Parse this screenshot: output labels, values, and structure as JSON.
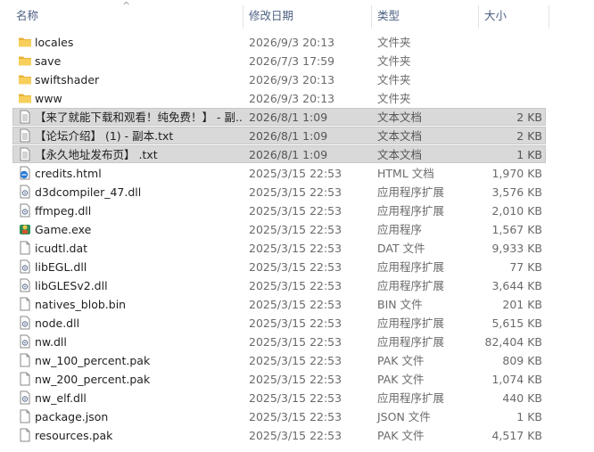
{
  "header": {
    "name": "名称",
    "date": "修改日期",
    "type": "类型",
    "size": "大小"
  },
  "rows": [
    {
      "name": "locales",
      "date": "2026/9/3 20:13",
      "type": "文件夹",
      "size": "",
      "icon": "folder-icon",
      "selected": false
    },
    {
      "name": "save",
      "date": "2026/7/3 17:59",
      "type": "文件夹",
      "size": "",
      "icon": "folder-icon",
      "selected": false
    },
    {
      "name": "swiftshader",
      "date": "2026/9/3 20:13",
      "type": "文件夹",
      "size": "",
      "icon": "folder-icon",
      "selected": false
    },
    {
      "name": "www",
      "date": "2026/9/3 20:13",
      "type": "文件夹",
      "size": "",
      "icon": "folder-icon",
      "selected": false
    },
    {
      "name": "【来了就能下载和观看！纯免费！】 - 副...",
      "date": "2026/8/1 1:09",
      "type": "文本文档",
      "size": "2 KB",
      "icon": "text-file-icon",
      "selected": true
    },
    {
      "name": "【论坛介绍】 (1) - 副本.txt",
      "date": "2026/8/1 1:09",
      "type": "文本文档",
      "size": "2 KB",
      "icon": "text-file-icon",
      "selected": true
    },
    {
      "name": "【永久地址发布页】 .txt",
      "date": "2026/8/1 1:09",
      "type": "文本文档",
      "size": "1 KB",
      "icon": "text-file-icon",
      "selected": true
    },
    {
      "name": "credits.html",
      "date": "2025/3/15 22:53",
      "type": "HTML 文档",
      "size": "1,970 KB",
      "icon": "html-file-icon",
      "selected": false
    },
    {
      "name": "d3dcompiler_47.dll",
      "date": "2025/3/15 22:53",
      "type": "应用程序扩展",
      "size": "3,576 KB",
      "icon": "dll-file-icon",
      "selected": false
    },
    {
      "name": "ffmpeg.dll",
      "date": "2025/3/15 22:53",
      "type": "应用程序扩展",
      "size": "2,010 KB",
      "icon": "dll-file-icon",
      "selected": false
    },
    {
      "name": "Game.exe",
      "date": "2025/3/15 22:53",
      "type": "应用程序",
      "size": "1,567 KB",
      "icon": "game-exe-icon",
      "selected": false
    },
    {
      "name": "icudtl.dat",
      "date": "2025/3/15 22:53",
      "type": "DAT 文件",
      "size": "9,933 KB",
      "icon": "generic-file-icon",
      "selected": false
    },
    {
      "name": "libEGL.dll",
      "date": "2025/3/15 22:53",
      "type": "应用程序扩展",
      "size": "77 KB",
      "icon": "dll-file-icon",
      "selected": false
    },
    {
      "name": "libGLESv2.dll",
      "date": "2025/3/15 22:53",
      "type": "应用程序扩展",
      "size": "3,644 KB",
      "icon": "dll-file-icon",
      "selected": false
    },
    {
      "name": "natives_blob.bin",
      "date": "2025/3/15 22:53",
      "type": "BIN 文件",
      "size": "201 KB",
      "icon": "generic-file-icon",
      "selected": false
    },
    {
      "name": "node.dll",
      "date": "2025/3/15 22:53",
      "type": "应用程序扩展",
      "size": "5,615 KB",
      "icon": "dll-file-icon",
      "selected": false
    },
    {
      "name": "nw.dll",
      "date": "2025/3/15 22:53",
      "type": "应用程序扩展",
      "size": "82,404 KB",
      "icon": "dll-file-icon",
      "selected": false
    },
    {
      "name": "nw_100_percent.pak",
      "date": "2025/3/15 22:53",
      "type": "PAK 文件",
      "size": "809 KB",
      "icon": "generic-file-icon",
      "selected": false
    },
    {
      "name": "nw_200_percent.pak",
      "date": "2025/3/15 22:53",
      "type": "PAK 文件",
      "size": "1,074 KB",
      "icon": "generic-file-icon",
      "selected": false
    },
    {
      "name": "nw_elf.dll",
      "date": "2025/3/15 22:53",
      "type": "应用程序扩展",
      "size": "440 KB",
      "icon": "dll-file-icon",
      "selected": false
    },
    {
      "name": "package.json",
      "date": "2025/3/15 22:53",
      "type": "JSON 文件",
      "size": "1 KB",
      "icon": "generic-file-icon",
      "selected": false
    },
    {
      "name": "resources.pak",
      "date": "2025/3/15 22:53",
      "type": "PAK 文件",
      "size": "4,517 KB",
      "icon": "generic-file-icon",
      "selected": false
    }
  ],
  "colors": {
    "folder": "#f4c64f",
    "selection": "#d9d9d9",
    "header_text": "#4d6082"
  }
}
